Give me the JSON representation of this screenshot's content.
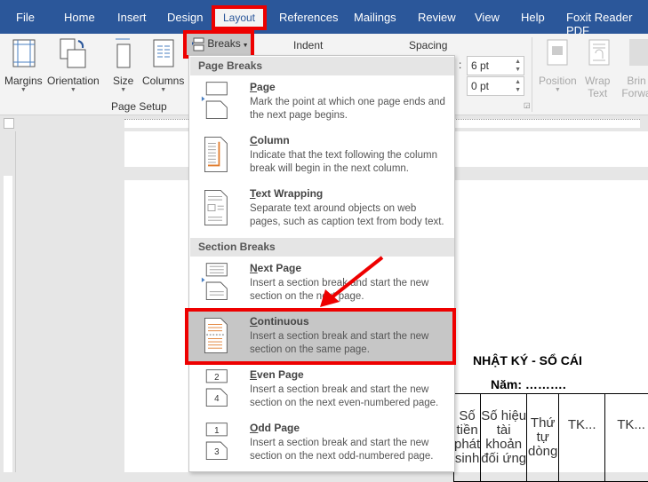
{
  "tabs": [
    "File",
    "Home",
    "Insert",
    "Design",
    "Layout",
    "References",
    "Mailings",
    "Review",
    "View",
    "Help",
    "Foxit Reader PDF"
  ],
  "ribbon": {
    "margins": "Margins",
    "orientation": "Orientation",
    "size": "Size",
    "columns": "Columns",
    "breaks": "Breaks",
    "indent": "Indent",
    "spacing": "Spacing",
    "spacing_before": "6 pt",
    "spacing_after": "0 pt",
    "page_setup": "Page Setup",
    "position": "Position",
    "wrap": "Wrap",
    "wrap2": "Text",
    "bring": "Brin",
    "bring2": "Forwa"
  },
  "menu": {
    "page_breaks": "Page Breaks",
    "section_breaks": "Section Breaks",
    "items": [
      {
        "key": "P",
        "rest": "age",
        "desc": "Mark the point at which one page ends and the next page begins."
      },
      {
        "key": "C",
        "rest": "olumn",
        "desc": "Indicate that the text following the column break will begin in the next column."
      },
      {
        "key": "T",
        "rest": "ext Wrapping",
        "desc": "Separate text around objects on web pages, such as caption text from body text."
      },
      {
        "key": "N",
        "rest": "ext Page",
        "desc": "Insert a section break and start the new section on the next page."
      },
      {
        "key": "C",
        "rest": "ontinuous",
        "desc": "Insert a section break and start the new section on the same page."
      },
      {
        "key": "E",
        "rest": "ven Page",
        "desc": "Insert a section break and start the new section on the next even-numbered page."
      },
      {
        "key": "O",
        "rest": "dd Page",
        "desc": "Insert a section break and start the new section on the next odd-numbered page."
      }
    ]
  },
  "doc": {
    "title": "NHẬT KÝ - SỔ CÁI",
    "year": "Năm: ……….",
    "cols": [
      "Số tiền phát sinh",
      "Số hiệu tài khoản đối ứng",
      "Thứ tự dòng",
      "TK...",
      "TK..."
    ]
  },
  "colors": {
    "ribbon_blue": "#2b579a",
    "highlight_red": "#e00000"
  }
}
